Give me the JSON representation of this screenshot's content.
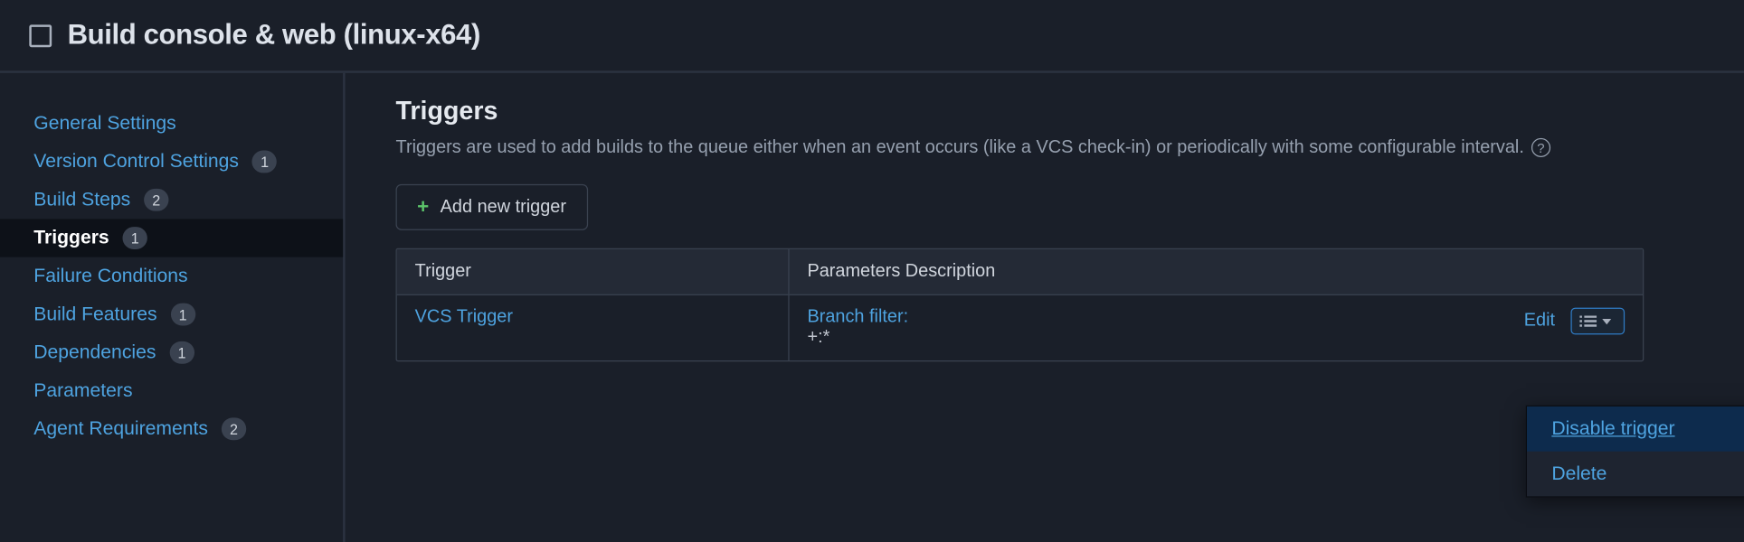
{
  "header": {
    "title": "Build console & web (linux-x64)"
  },
  "sidebar": {
    "items": [
      {
        "label": "General Settings",
        "badge": null,
        "active": false
      },
      {
        "label": "Version Control Settings",
        "badge": "1",
        "active": false
      },
      {
        "label": "Build Steps",
        "badge": "2",
        "active": false
      },
      {
        "label": "Triggers",
        "badge": "1",
        "active": true
      },
      {
        "label": "Failure Conditions",
        "badge": null,
        "active": false
      },
      {
        "label": "Build Features",
        "badge": "1",
        "active": false
      },
      {
        "label": "Dependencies",
        "badge": "1",
        "active": false
      },
      {
        "label": "Parameters",
        "badge": null,
        "active": false
      },
      {
        "label": "Agent Requirements",
        "badge": "2",
        "active": false
      }
    ]
  },
  "main": {
    "title": "Triggers",
    "description": "Triggers are used to add builds to the queue either when an event occurs (like a VCS check-in) or periodically with some configurable interval.",
    "add_button": "Add new trigger",
    "table": {
      "headers": {
        "trigger": "Trigger",
        "params": "Parameters Description"
      },
      "row": {
        "trigger": "VCS Trigger",
        "params_label": "Branch filter:",
        "params_value": "+:*",
        "edit": "Edit"
      }
    }
  },
  "dropdown": {
    "items": [
      {
        "label": "Disable trigger",
        "highlighted": true
      },
      {
        "label": "Delete",
        "highlighted": false
      }
    ]
  }
}
